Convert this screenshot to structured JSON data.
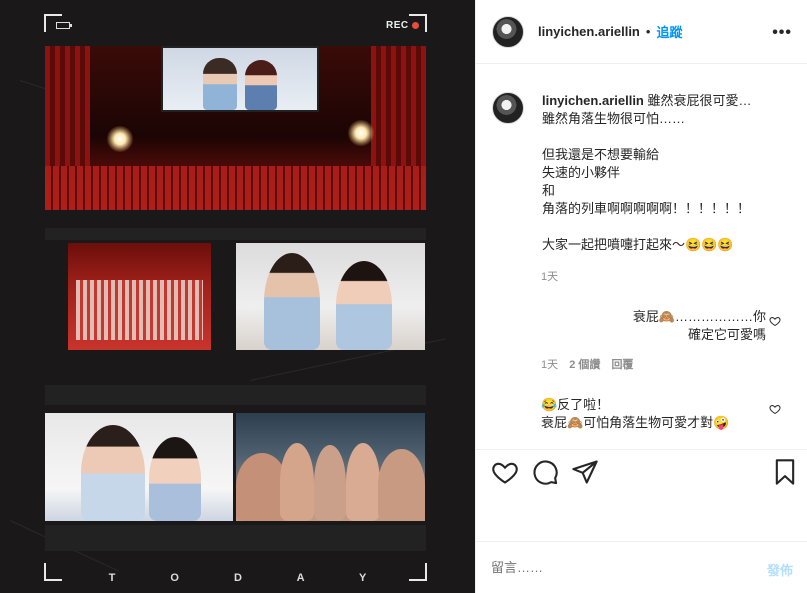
{
  "photo": {
    "rec_label": "REC",
    "bottom_label": "T O D A Y"
  },
  "header": {
    "username": "linyichen.ariellin",
    "separator": "•",
    "follow_label": "追蹤",
    "more_icon": "more-horizontal-icon"
  },
  "caption": {
    "username": "linyichen.ariellin",
    "text": "雖然衰屁很可愛…\n雖然角落生物很可怕……\n\n但我還是不想要輸給\n失速的小夥伴\n和\n角落的列車啊啊啊啊啊！！！！！！\n\n大家一起把噴嚏打起來～😆😆😆",
    "time": "1天"
  },
  "comments": [
    {
      "text": "衰屁🙈………………你\n確定它可愛嗎",
      "time": "1天",
      "likes": "2 個讚",
      "reply_label": "回覆"
    },
    {
      "text": "😂反了啦！\n衰屁🙈可怕角落生物可愛才對🤪"
    }
  ],
  "actions": {
    "like_icon": "heart-icon",
    "comment_icon": "comment-icon",
    "share_icon": "paper-plane-icon",
    "save_icon": "bookmark-icon"
  },
  "footer": {
    "comment_placeholder": "留言……",
    "post_label": "發佈"
  }
}
